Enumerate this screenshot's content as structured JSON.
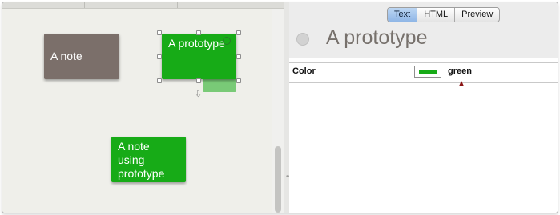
{
  "canvas": {
    "notes": [
      {
        "label": "A note",
        "color": "#7b6f6a"
      },
      {
        "label": "A prototype",
        "color": "#17ab17",
        "selected": true
      },
      {
        "label": "A note using prototype",
        "color": "#17ab17"
      }
    ]
  },
  "inspector": {
    "view_tabs": [
      "Text",
      "HTML",
      "Preview"
    ],
    "active_tab": "Text",
    "note_title": "A prototype",
    "attributes": [
      {
        "name": "Color",
        "value": "green",
        "swatch": "#17ab17"
      }
    ]
  },
  "annotation": {
    "arrow_color": "#8b1414"
  }
}
